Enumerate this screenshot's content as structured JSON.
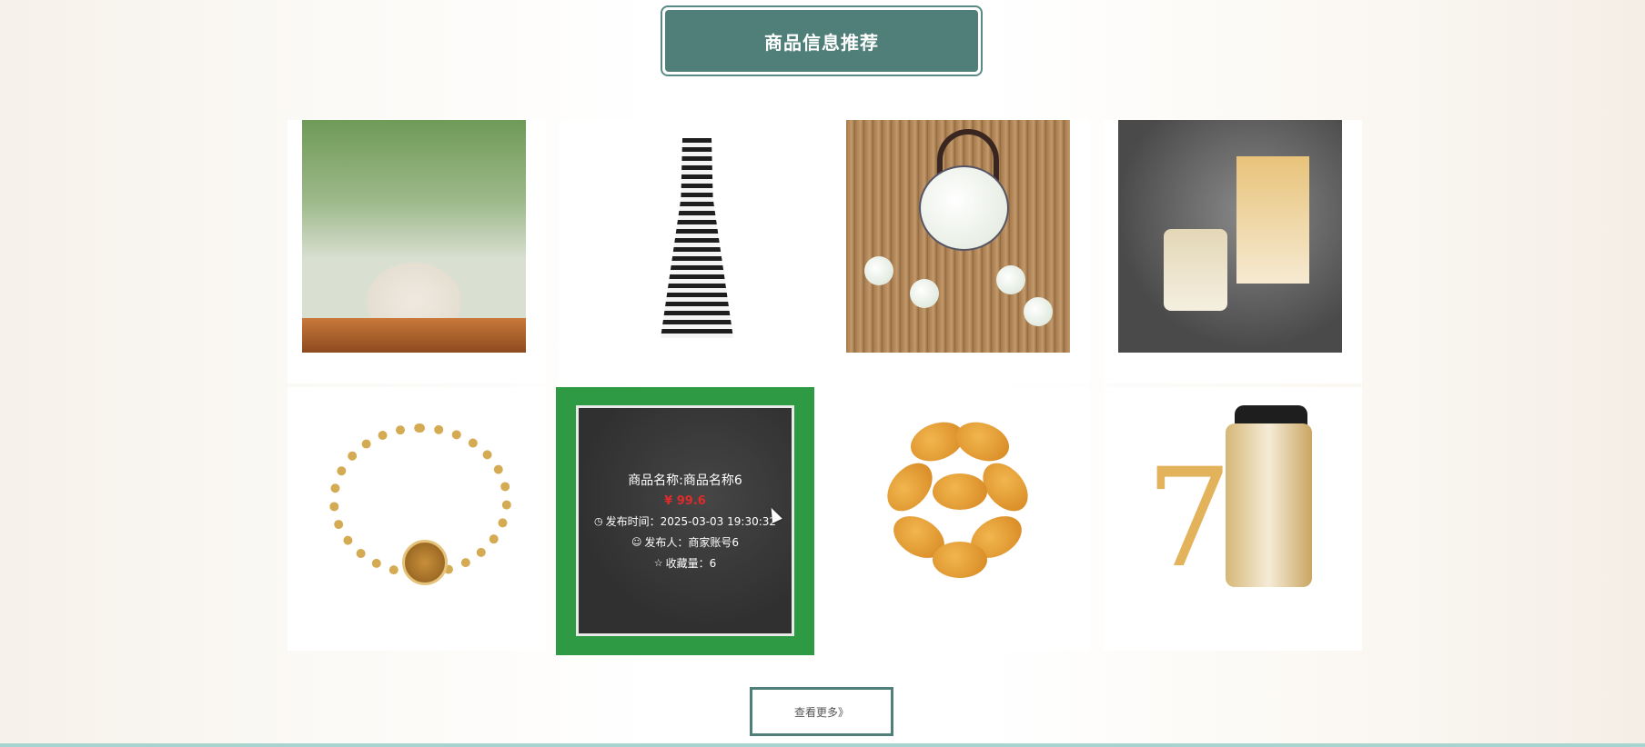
{
  "section": {
    "title": "商品信息推荐"
  },
  "products": [
    {
      "image": "flour-powder"
    },
    {
      "image": "striped-dress"
    },
    {
      "image": "tea-set"
    },
    {
      "image": "honey-jar"
    },
    {
      "image": "gold-bracelet"
    },
    {
      "image": "honey-jar",
      "hovered": true,
      "name": "商品名称:商品名称6",
      "price": "¥ 99.6",
      "publish_time": "发布时间：2025-03-03 19:30:32",
      "publisher": "发布人：商家账号6",
      "favorites": "收藏量：6"
    },
    {
      "image": "fried-food"
    },
    {
      "image": "olay-cream"
    }
  ],
  "more_button": {
    "label": "查看更多》"
  },
  "colors": {
    "accent": "#4f7f78",
    "hover": "#2e9a43",
    "price": "#e02b2b"
  },
  "icons": {
    "time": "clock-icon",
    "user": "user-icon",
    "star": "star-icon"
  }
}
